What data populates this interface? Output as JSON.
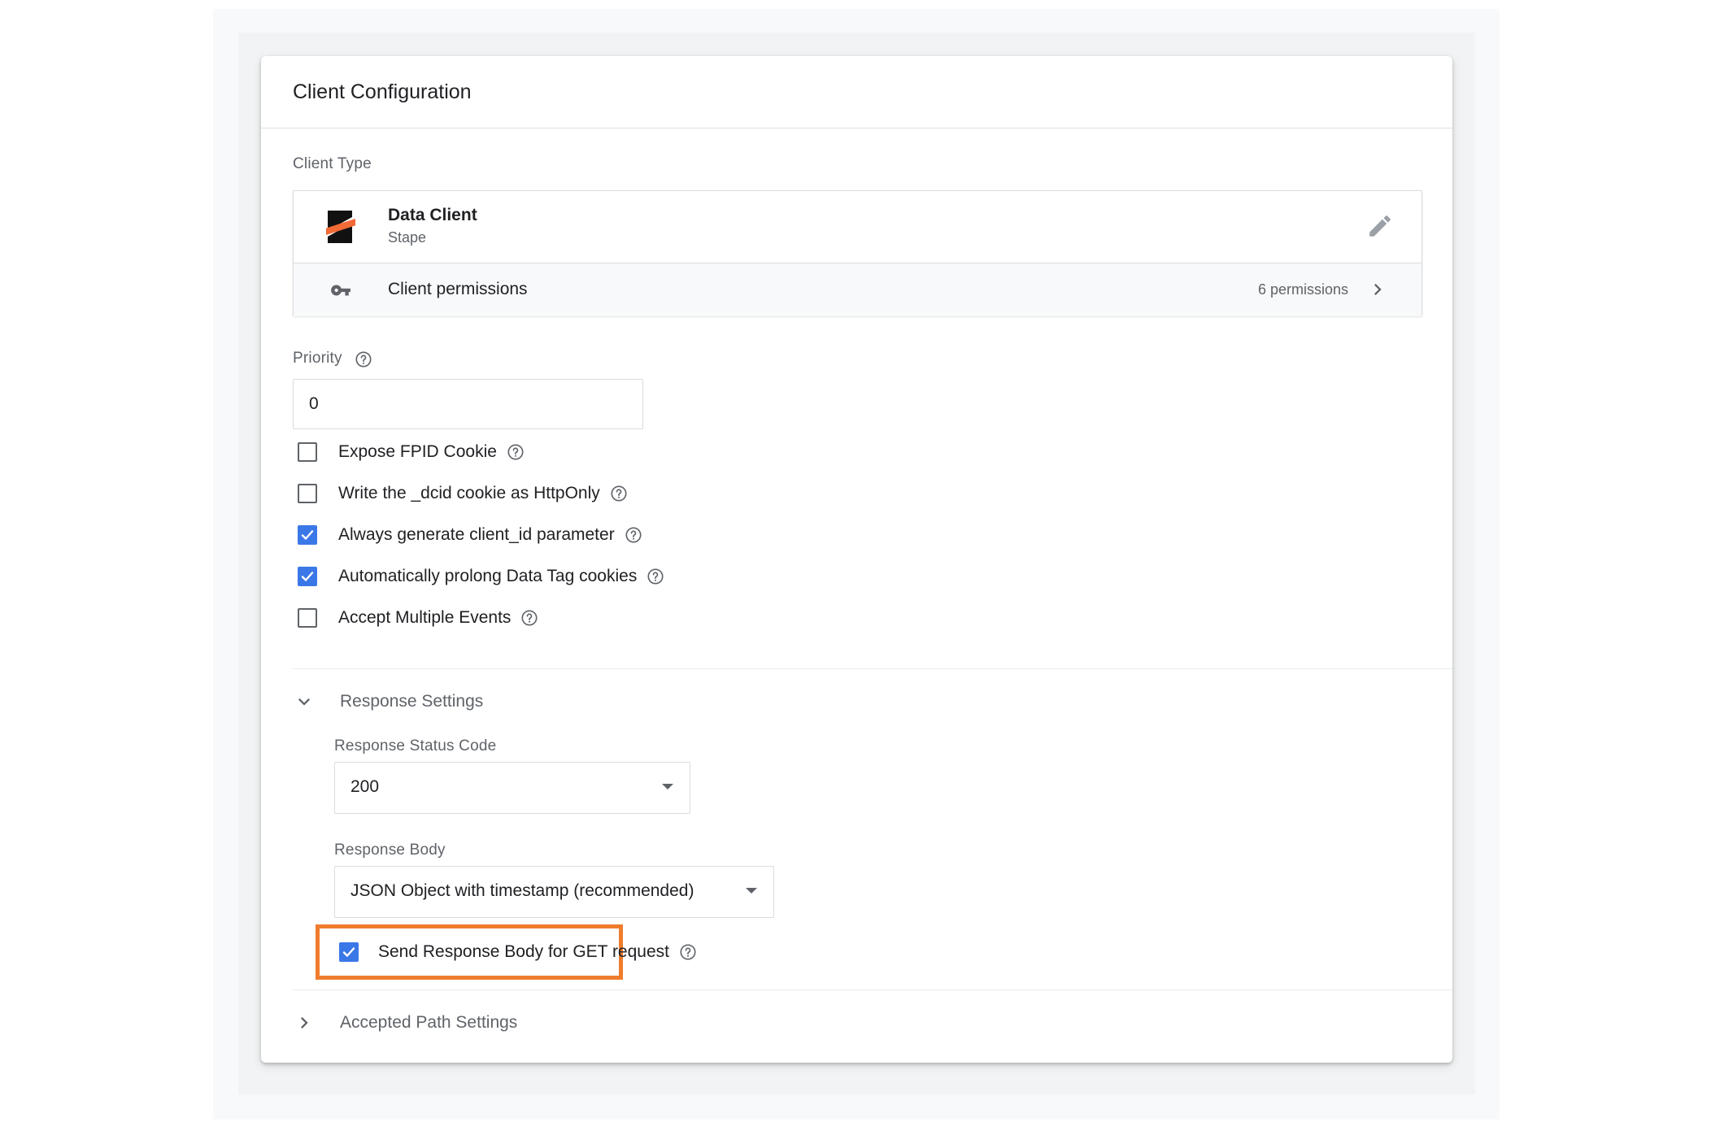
{
  "card": {
    "title": "Client Configuration"
  },
  "client_type": {
    "label": "Client Type",
    "name": "Data Client",
    "vendor": "Stape",
    "permissions_label": "Client permissions",
    "permissions_count": "6 permissions"
  },
  "priority": {
    "label": "Priority",
    "value": "0"
  },
  "options": [
    {
      "label": "Expose FPID Cookie",
      "checked": false
    },
    {
      "label": "Write the _dcid cookie as HttpOnly",
      "checked": false
    },
    {
      "label": "Always generate client_id parameter",
      "checked": true
    },
    {
      "label": "Automatically prolong Data Tag cookies",
      "checked": true
    },
    {
      "label": "Accept Multiple Events",
      "checked": false
    }
  ],
  "response_settings": {
    "title": "Response Settings",
    "expanded": true,
    "status_code_label": "Response Status Code",
    "status_code_value": "200",
    "body_label": "Response Body",
    "body_value": "JSON Object with timestamp (recommended)",
    "send_body_get_label": "Send Response Body for GET request",
    "send_body_get_checked": true
  },
  "accepted_path_settings": {
    "title": "Accepted Path Settings",
    "expanded": false
  },
  "colors": {
    "checkbox_accent": "#3b78e7",
    "highlight": "#f07c2d",
    "logo_accent": "#f26a35"
  },
  "icons": [
    "stape-logo-icon",
    "edit-pencil-icon",
    "key-icon",
    "chevron-right-icon",
    "help-icon",
    "checkmark-icon",
    "chevron-down-icon",
    "dropdown-arrow-icon"
  ]
}
